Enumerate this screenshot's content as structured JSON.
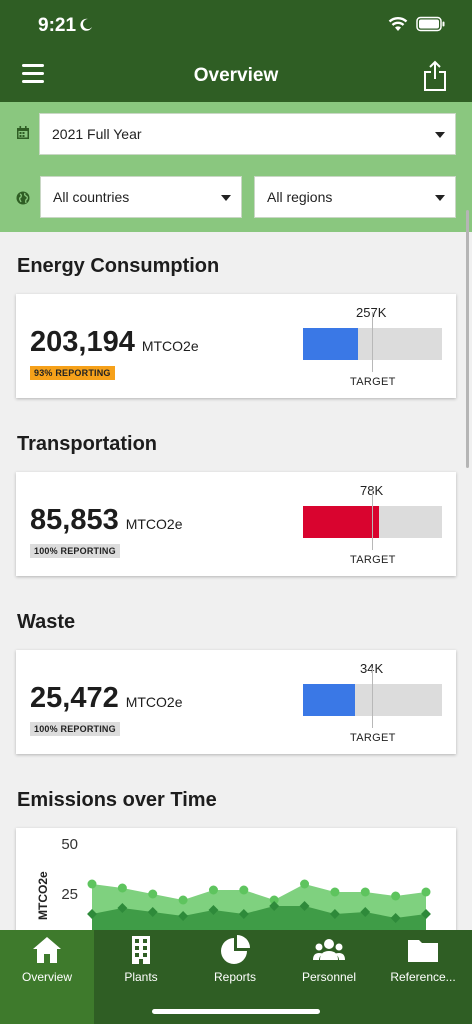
{
  "status": {
    "time": "9:21"
  },
  "header": {
    "title": "Overview"
  },
  "filters": {
    "period": "2021 Full Year",
    "country": "All countries",
    "region": "All regions"
  },
  "sections": [
    {
      "title": "Energy Consumption",
      "value": "203,194",
      "unit": "MTCO2e",
      "badge": "93% REPORTING",
      "badge_color": "#f6a11a",
      "target": "257K",
      "target_label": "TARGET",
      "progress_fraction": 0.79,
      "bar_color": "#3a78e6"
    },
    {
      "title": "Transportation",
      "value": "85,853",
      "unit": "MTCO2e",
      "badge": "100% REPORTING",
      "badge_color": "#dcdcdc",
      "target": "78K",
      "target_label": "TARGET",
      "progress_fraction": 1.1,
      "bar_color": "#d9042f"
    },
    {
      "title": "Waste",
      "value": "25,472",
      "unit": "MTCO2e",
      "badge": "100% REPORTING",
      "badge_color": "#dcdcdc",
      "target": "34K",
      "target_label": "TARGET",
      "progress_fraction": 0.75,
      "bar_color": "#3a78e6"
    }
  ],
  "emissions": {
    "title": "Emissions over Time"
  },
  "chart_data": {
    "type": "area",
    "ylabel": "MTCO2e",
    "yticks": [
      "50",
      "25"
    ],
    "ylim": [
      0,
      50
    ],
    "series": [
      {
        "values": [
          30,
          28,
          25,
          22,
          27,
          27,
          22,
          30,
          26,
          26,
          24,
          26
        ],
        "color": "#7fd17f"
      },
      {
        "values": [
          15,
          18,
          16,
          14,
          17,
          15,
          19,
          19,
          15,
          16,
          13,
          15
        ],
        "color": "#3f9c47"
      },
      {
        "values": [
          2,
          3,
          2,
          2,
          3,
          2,
          3,
          3,
          2,
          2,
          2,
          2
        ],
        "color": "#1f6e2a"
      }
    ]
  },
  "tabs": [
    {
      "label": "Overview",
      "icon": "home-icon"
    },
    {
      "label": "Plants",
      "icon": "building-icon"
    },
    {
      "label": "Reports",
      "icon": "pie-chart-icon"
    },
    {
      "label": "Personnel",
      "icon": "people-icon"
    },
    {
      "label": "Reference...",
      "icon": "folder-icon"
    }
  ],
  "colors": {
    "header": "#2f5e24",
    "filter_bg": "#8ac77f",
    "tab_active": "#3e7a2c"
  }
}
